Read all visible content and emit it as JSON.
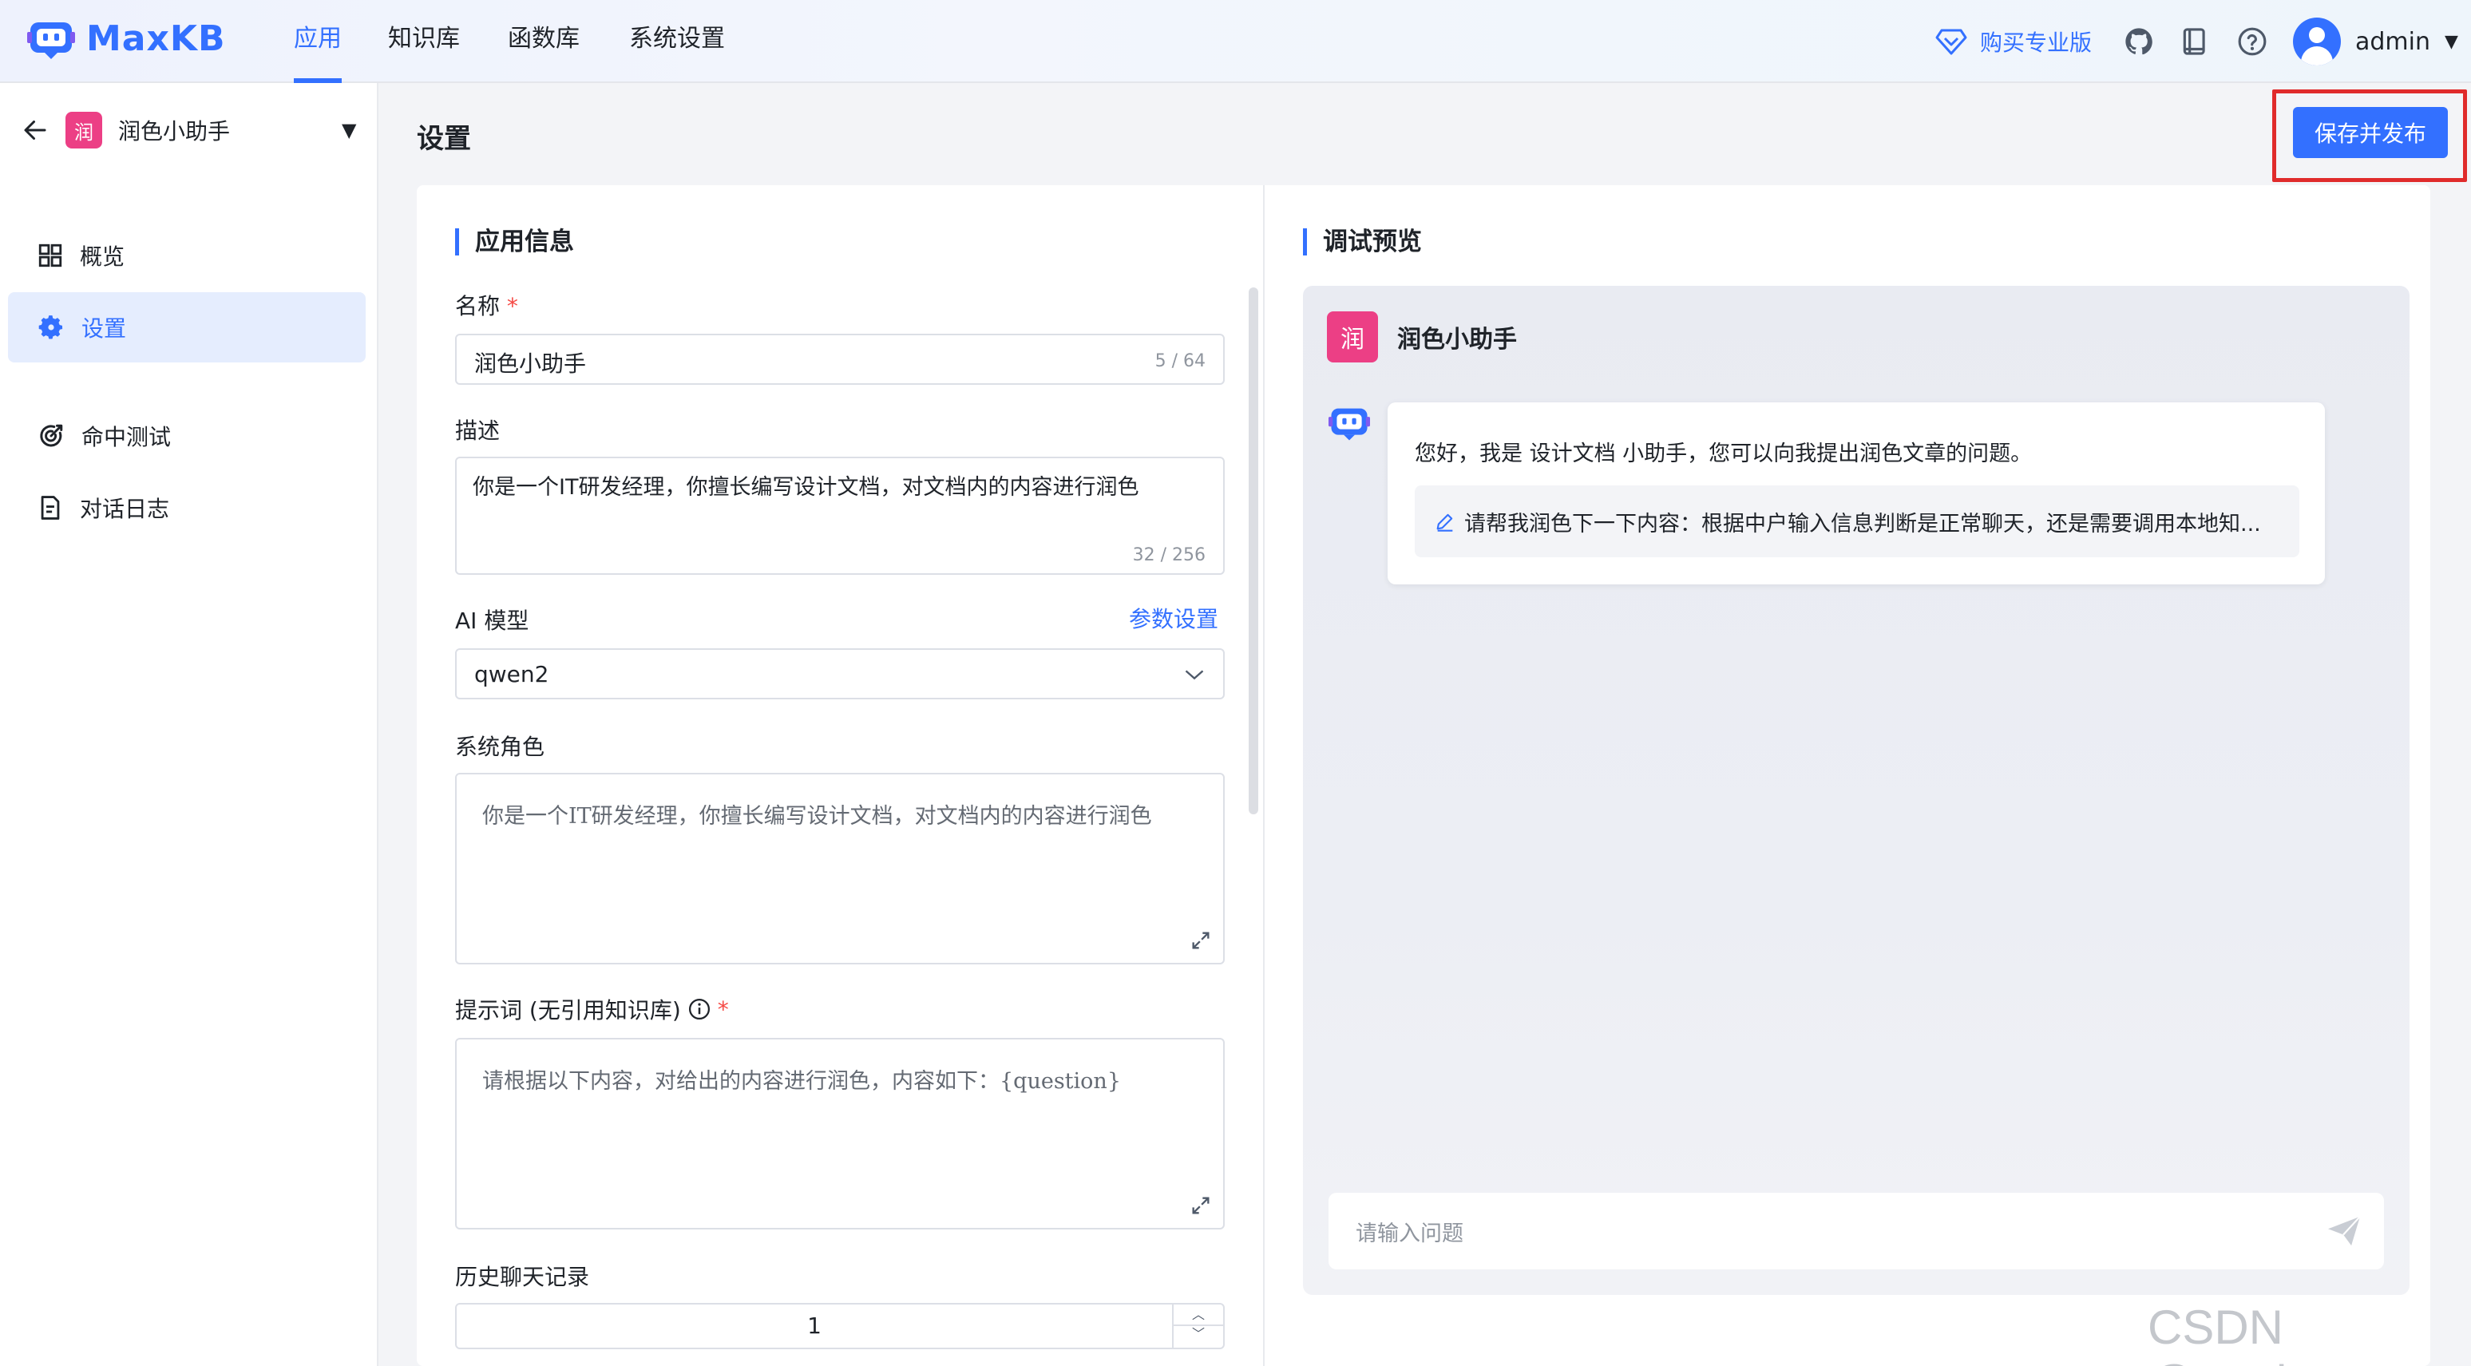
{
  "app": {
    "name": "MaxKB"
  },
  "nav": {
    "items": [
      {
        "label": "应用",
        "active": true
      },
      {
        "label": "知识库"
      },
      {
        "label": "函数库"
      },
      {
        "label": "系统设置"
      }
    ]
  },
  "header": {
    "buy_pro": "购买专业版",
    "user": "admin",
    "icons": [
      "diamond-icon",
      "github-icon",
      "book-icon",
      "help-icon",
      "user-avatar-icon",
      "caret-down-icon"
    ]
  },
  "sidebar": {
    "app_badge": "润",
    "app_name": "润色小助手",
    "items": [
      {
        "label": "概览",
        "icon": "overview-grid-icon"
      },
      {
        "label": "设置",
        "icon": "gear-icon",
        "active": true
      },
      {
        "label": "命中测试",
        "icon": "target-icon"
      },
      {
        "label": "对话日志",
        "icon": "document-icon"
      }
    ]
  },
  "page": {
    "title": "设置",
    "publish_label": "保存并发布"
  },
  "form": {
    "section_title": "应用信息",
    "name_label": "名称",
    "required_mark": "*",
    "name_value": "润色小助手",
    "name_counter": "5 / 64",
    "desc_label": "描述",
    "desc_value": "你是一个IT研发经理，你擅长编写设计文档，对文档内的内容进行润色",
    "desc_counter": "32 / 256",
    "model_label": "AI 模型",
    "model_params_link": "参数设置",
    "model_value": "qwen2",
    "role_label": "系统角色",
    "role_value": "你是一个IT研发经理，你擅长编写设计文档，对文档内的内容进行润色",
    "prompt_label": "提示词 (无引用知识库)",
    "prompt_value": "请根据以下内容，对给出的内容进行润色，内容如下：{question}",
    "history_label": "历史聊天记录",
    "history_value": "1"
  },
  "preview": {
    "section_title": "调试预览",
    "app_badge": "润",
    "app_name": "润色小助手",
    "greeting": "您好，我是 设计文档 小助手，您可以向我提出润色文章的问题。",
    "suggestion": "请帮我润色下一下内容：根据中户输入信息判断是正常聊天，还是需要调用本地知...",
    "input_placeholder": "请输入问题"
  },
  "watermark": "CSDN @pp_lan",
  "colors": {
    "accent": "#3370ff",
    "badge": "#ec3f85",
    "highlight_box": "#e02b2b"
  }
}
